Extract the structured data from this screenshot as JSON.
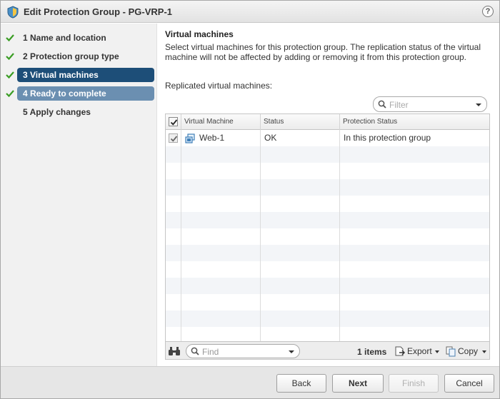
{
  "window": {
    "title": "Edit Protection Group - PG-VRP-1",
    "help_label": "?"
  },
  "steps": [
    {
      "label": "1  Name and location",
      "status": "complete"
    },
    {
      "label": "2  Protection group type",
      "status": "complete"
    },
    {
      "label": "3  Virtual machines",
      "status": "current"
    },
    {
      "label": "4  Ready to complete",
      "status": "complete"
    },
    {
      "label": "5  Apply changes",
      "status": "pending"
    }
  ],
  "main": {
    "section_title": "Virtual machines",
    "description": "Select virtual machines for this protection group. The replication status of the virtual machine will not be affected by adding or removing it from this protection group.",
    "replicated_label": "Replicated virtual machines:",
    "filter_placeholder": "Filter"
  },
  "table": {
    "columns": [
      "Virtual Machine",
      "Status",
      "Protection Status"
    ],
    "rows": [
      {
        "checked": true,
        "vm": "Web-1",
        "status": "OK",
        "protection_status": "In this protection group"
      }
    ],
    "header_checked": true
  },
  "footer": {
    "find_placeholder": "Find",
    "item_count": "1 items",
    "export_label": "Export",
    "copy_label": "Copy"
  },
  "buttons": {
    "back": "Back",
    "next": "Next",
    "finish": "Finish",
    "cancel": "Cancel"
  },
  "colors": {
    "current_step": "#1d4e78",
    "ready_step": "#6b8fb1",
    "check_green": "#3a9d23"
  }
}
